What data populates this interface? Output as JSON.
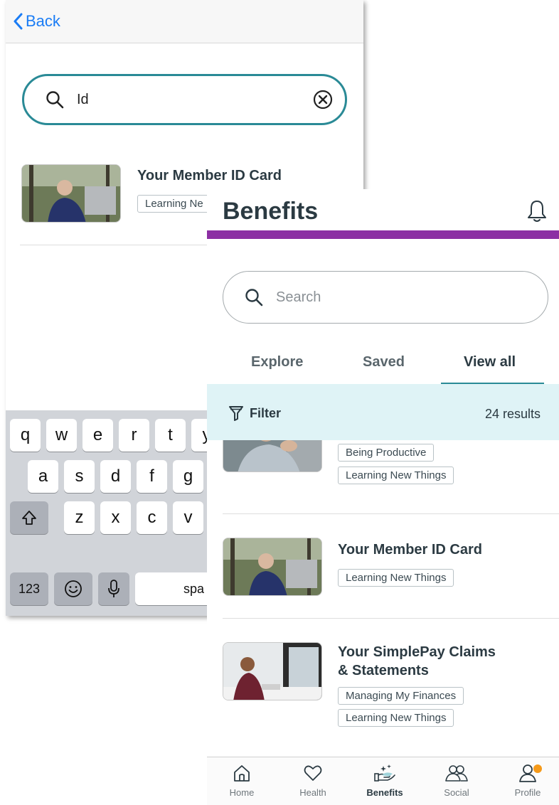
{
  "search_screen": {
    "back_label": "Back",
    "query": "Id",
    "result": {
      "title": "Your Member ID Card",
      "tag": "Learning Ne"
    },
    "keyboard": {
      "row1": [
        "q",
        "w",
        "e",
        "r",
        "t",
        "y"
      ],
      "row2": [
        "a",
        "s",
        "d",
        "f",
        "g"
      ],
      "row3": [
        "z",
        "x",
        "c",
        "v"
      ],
      "numbers_key": "123",
      "space_key": "spa"
    }
  },
  "benefits_screen": {
    "title": "Benefits",
    "search_placeholder": "Search",
    "tabs": [
      {
        "label": "Explore"
      },
      {
        "label": "Saved"
      },
      {
        "label": "View all"
      }
    ],
    "active_tab": "View all",
    "filter_label": "Filter",
    "results_count": "24 results",
    "items": [
      {
        "title": "",
        "tags": [
          "Being Productive",
          "Learning New Things"
        ]
      },
      {
        "title": "Your Member ID Card",
        "tags": [
          "Learning New Things"
        ]
      },
      {
        "title_line1": "Your SimplePay Claims",
        "title_line2": "& Statements",
        "tags": [
          "Managing My Finances",
          "Learning New Things"
        ]
      }
    ],
    "tabbar": [
      {
        "label": "Home",
        "icon": "home-icon"
      },
      {
        "label": "Health",
        "icon": "heart-icon"
      },
      {
        "label": "Benefits",
        "icon": "benefits-hand-icon"
      },
      {
        "label": "Social",
        "icon": "people-icon"
      },
      {
        "label": "Profile",
        "icon": "person-icon"
      }
    ],
    "active_nav": "Benefits"
  },
  "colors": {
    "accent_teal": "#2a8a96",
    "brand_purple": "#8c2fa3",
    "filter_bg": "#dff3f6",
    "ios_blue": "#1a7cf5",
    "notification": "#f59a1a"
  }
}
